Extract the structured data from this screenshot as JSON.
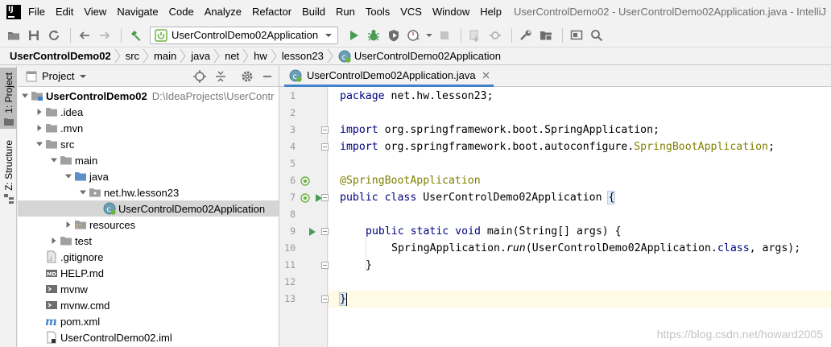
{
  "window": {
    "title": "UserControlDemo02 - UserControlDemo02Application.java - IntelliJ"
  },
  "menu": [
    "File",
    "Edit",
    "View",
    "Navigate",
    "Code",
    "Analyze",
    "Refactor",
    "Build",
    "Run",
    "Tools",
    "VCS",
    "Window",
    "Help"
  ],
  "toolbar": {
    "run_config": "UserControlDemo02Application",
    "icons": [
      "open-folder-icon",
      "save-icon",
      "sync-icon",
      "back-arrow-icon",
      "forward-arrow-icon",
      "build-hammer-icon",
      "run-icon",
      "debug-icon",
      "coverage-icon",
      "profile-icon",
      "stop-icon",
      "vcs-update-icon",
      "vcs-commit-icon",
      "wrench-icon",
      "project-structure-icon",
      "presentation-icon",
      "search-icon"
    ]
  },
  "breadcrumb": [
    "UserControlDemo02",
    "src",
    "main",
    "java",
    "net",
    "hw",
    "lesson23",
    "UserControlDemo02Application"
  ],
  "tool_windows": {
    "project_tab": "1: Project",
    "structure_tab": "Z: Structure"
  },
  "project_panel": {
    "title": "Project",
    "tree": [
      {
        "label": "UserControlDemo02",
        "path": "D:\\IdeaProjects\\UserContr",
        "icon": "module-folder-icon",
        "expanded": true,
        "bold": true
      },
      {
        "label": ".idea",
        "icon": "folder-icon",
        "expanded": false
      },
      {
        "label": ".mvn",
        "icon": "folder-icon",
        "expanded": false
      },
      {
        "label": "src",
        "icon": "folder-icon",
        "expanded": true
      },
      {
        "label": "main",
        "icon": "folder-icon",
        "expanded": true
      },
      {
        "label": "java",
        "icon": "source-folder-icon",
        "expanded": true
      },
      {
        "label": "net.hw.lesson23",
        "icon": "package-icon",
        "expanded": true
      },
      {
        "label": "UserControlDemo02Application",
        "icon": "spring-class-icon",
        "selected": true
      },
      {
        "label": "resources",
        "icon": "resources-folder-icon",
        "expanded": false
      },
      {
        "label": "test",
        "icon": "folder-icon",
        "expanded": false
      },
      {
        "label": ".gitignore",
        "icon": "gitignore-file-icon"
      },
      {
        "label": "HELP.md",
        "icon": "markdown-file-icon"
      },
      {
        "label": "mvnw",
        "icon": "script-file-icon"
      },
      {
        "label": "mvnw.cmd",
        "icon": "script-file-icon"
      },
      {
        "label": "pom.xml",
        "icon": "maven-file-icon"
      },
      {
        "label": "UserControlDemo02.iml",
        "icon": "iml-file-icon"
      }
    ]
  },
  "editor": {
    "tab_label": "UserControlDemo02Application.java",
    "line_numbers": [
      "1",
      "2",
      "3",
      "4",
      "5",
      "6",
      "7",
      "8",
      "9",
      "10",
      "11",
      "12",
      "13"
    ],
    "code": {
      "l1_kw": "package",
      "l1_rest": " net.hw.lesson23;",
      "l3_kw": "import",
      "l3_rest": " org.springframework.boot.SpringApplication;",
      "l4_kw": "import",
      "l4_rest": " org.springframework.boot.autoconfigure.",
      "l4_ann": "SpringBootApplication",
      "l4_end": ";",
      "l6_ann": "@SpringBootApplication",
      "l7_kw": "public class",
      "l7_rest": " UserControlDemo02Application ",
      "l7_brace": "{",
      "l9_kw": "public static void",
      "l9_rest": " main(String[] args) {",
      "l10_a": "SpringApplication.",
      "l10_method": "run",
      "l10_b": "(UserControlDemo02Application.",
      "l10_kw": "class",
      "l10_c": ", args);",
      "l11": "}",
      "l13": "}"
    },
    "current_line": "13"
  },
  "watermark": "https://blog.csdn.net/howard2005"
}
